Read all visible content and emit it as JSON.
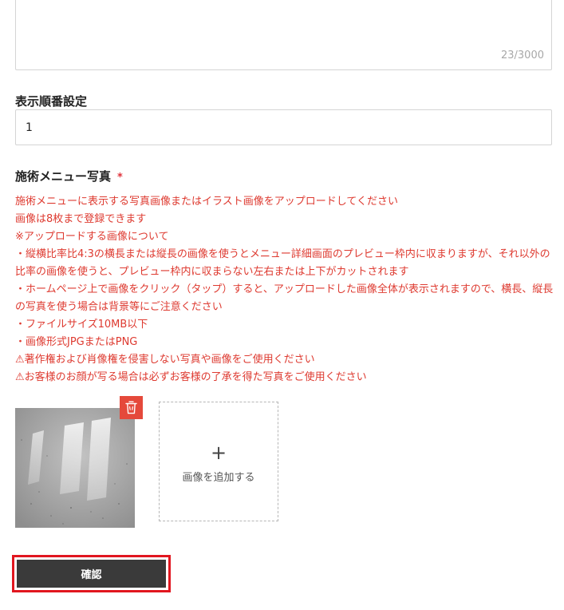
{
  "description_field": {
    "char_count": "23/3000"
  },
  "display_order": {
    "label": "表示順番設定",
    "value": "1"
  },
  "menu_photo": {
    "label": "施術メニュー写真",
    "required_mark": "*",
    "notes": [
      "施術メニューに表示する写真画像またはイラスト画像をアップロードしてください",
      "画像は8枚まで登録できます",
      "※アップロードする画像について",
      "・縦横比率比4:3の横長または縦長の画像を使うとメニュー詳細画面のプレビュー枠内に収まりますが、それ以外の比率の画像を使うと、プレビュー枠内に収まらない左右または上下がカットされます",
      "・ホームページ上で画像をクリック（タップ）すると、アップロードした画像全体が表示されますので、横長、縦長の写真を使う場合は背景等にご注意ください",
      "・ファイルサイズ10MB以下",
      "・画像形式JPGまたはPNG",
      "⚠著作権および肖像権を侵害しない写真や画像をご使用ください",
      "⚠お客様のお顔が写る場合は必ずお客様の了承を得た写真をご使用ください"
    ],
    "uploaded_image_icon": "trash-icon",
    "add_image": {
      "icon": "plus",
      "label": "画像を追加する"
    }
  },
  "confirm_button": {
    "label": "確認"
  },
  "colors": {
    "accent_red": "#de3a30",
    "delete_red": "#e5493b",
    "button_dark": "#3a3a3a",
    "highlight_red": "#e1161f"
  }
}
